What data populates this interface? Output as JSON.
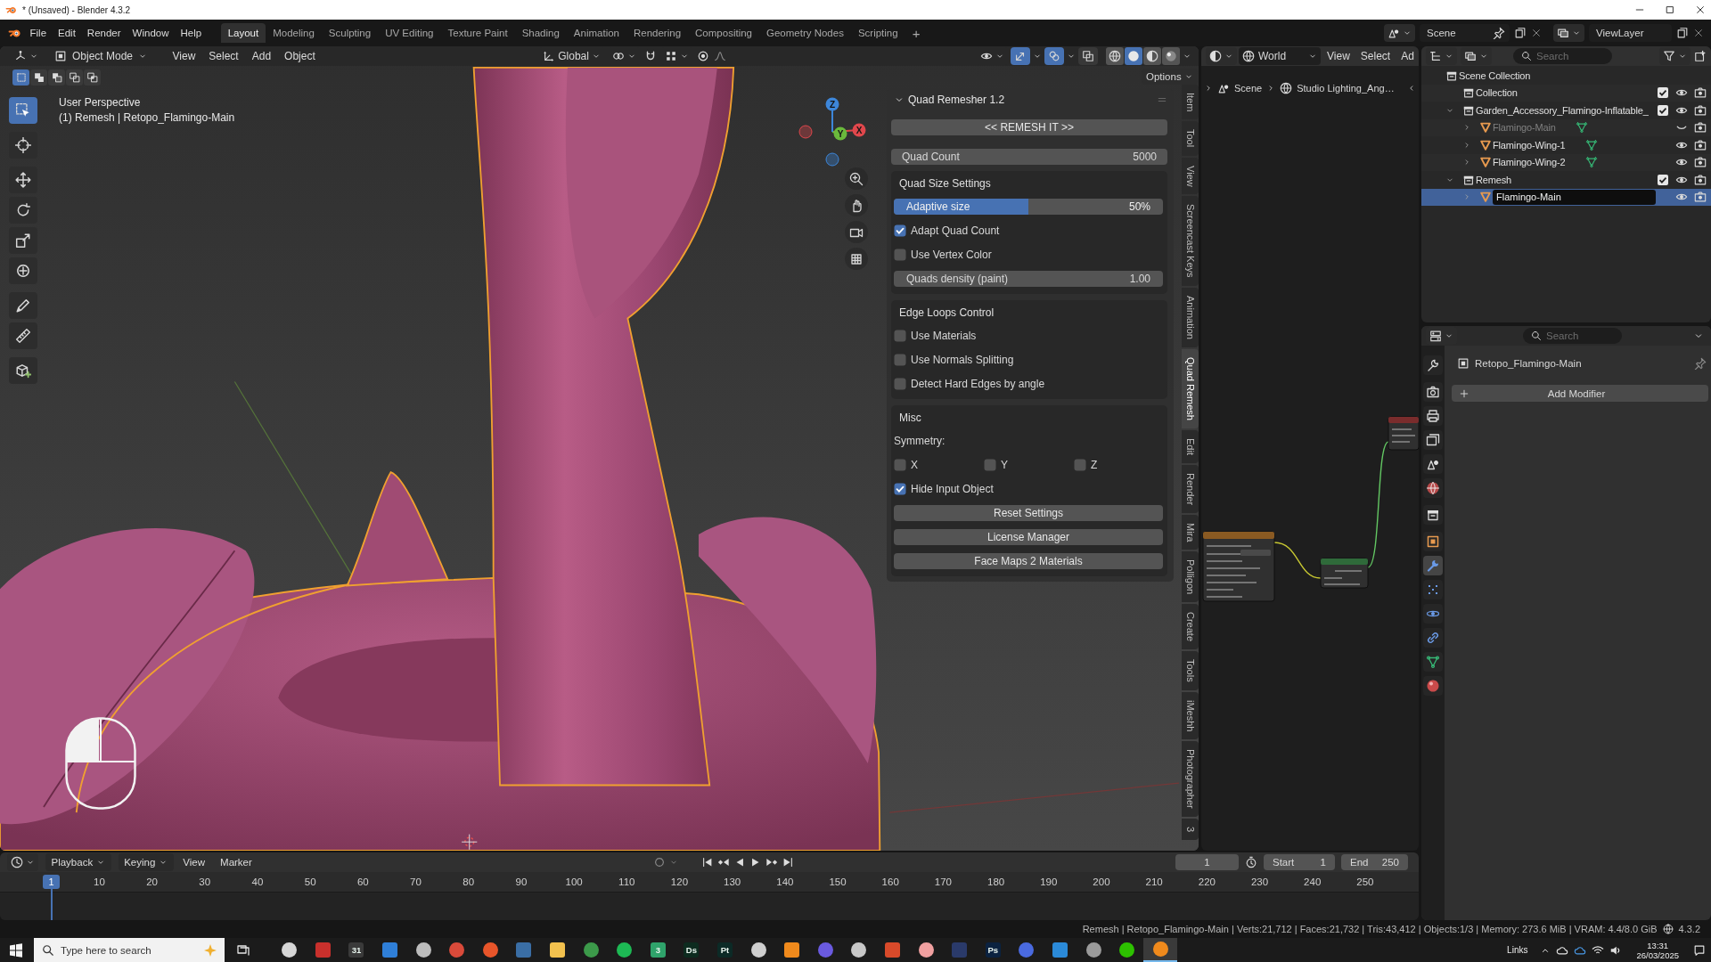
{
  "window": {
    "title": "* (Unsaved) - Blender 4.3.2"
  },
  "topbar": {
    "menus": [
      "File",
      "Edit",
      "Render",
      "Window",
      "Help"
    ],
    "workspaces": [
      {
        "label": "Layout",
        "selected": true
      },
      {
        "label": "Modeling",
        "selected": false
      },
      {
        "label": "Sculpting",
        "selected": false
      },
      {
        "label": "UV Editing",
        "selected": false
      },
      {
        "label": "Texture Paint",
        "selected": false
      },
      {
        "label": "Shading",
        "selected": false
      },
      {
        "label": "Animation",
        "selected": false
      },
      {
        "label": "Rendering",
        "selected": false
      },
      {
        "label": "Compositing",
        "selected": false
      },
      {
        "label": "Geometry Nodes",
        "selected": false
      },
      {
        "label": "Scripting",
        "selected": false
      }
    ],
    "add_workspace": "+",
    "scene": "Scene",
    "view_layer": "ViewLayer"
  },
  "viewport": {
    "mode": "Object Mode",
    "menus": [
      "View",
      "Select",
      "Add",
      "Object"
    ],
    "orientation": "Global",
    "toggles": [
      {
        "on": true
      },
      {
        "on": true
      },
      {
        "on": false
      }
    ],
    "shading": [
      {
        "selected": false
      },
      {
        "selected": true
      },
      {
        "selected": false
      },
      {
        "selected": false
      }
    ],
    "select_modes": [
      {
        "selected": true
      },
      {
        "selected": false
      },
      {
        "selected": false
      },
      {
        "selected": false
      },
      {
        "selected": false
      }
    ],
    "options": "Options",
    "info": [
      "User Perspective",
      "(1) Remesh | Retopo_Flamingo-Main"
    ],
    "tools": [
      {
        "selected": true
      },
      {
        "selected": false
      },
      {
        "selected": false
      },
      {
        "selected": false
      },
      {
        "selected": false
      },
      {
        "selected": false
      },
      {
        "selected": false
      },
      {
        "selected": false
      },
      {
        "selected": false
      }
    ],
    "gizmo": [
      {
        "label": "X",
        "color": "#e0474c"
      },
      {
        "label": "Y",
        "color": "#6ab93c"
      },
      {
        "label": "Z",
        "color": "#3d86d9"
      }
    ]
  },
  "sidebar_tabs": [
    {
      "label": "Item",
      "selected": false
    },
    {
      "label": "Tool",
      "selected": false
    },
    {
      "label": "View",
      "selected": false
    },
    {
      "label": "Screencast Keys",
      "selected": false
    },
    {
      "label": "Animation",
      "selected": false
    },
    {
      "label": "Quad Remesh",
      "selected": true
    },
    {
      "label": "Edit",
      "selected": false
    },
    {
      "label": "Render",
      "selected": false
    },
    {
      "label": "Mira",
      "selected": false
    },
    {
      "label": "Polligon",
      "selected": false
    },
    {
      "label": "Create",
      "selected": false
    },
    {
      "label": "Tools",
      "selected": false
    },
    {
      "label": "iMeshh",
      "selected": false
    },
    {
      "label": "Photographer",
      "selected": false
    },
    {
      "label": "3",
      "selected": false
    }
  ],
  "quad_remesher": {
    "title": "Quad Remesher 1.2",
    "expanded": true,
    "remesh_button": "<< REMESH IT >>",
    "quad_count": {
      "label": "Quad Count",
      "value": "5000"
    },
    "sections": [
      {
        "title": "Quad Size Settings",
        "rows": [
          {
            "kind": "slider",
            "label": "Adaptive size",
            "value": "50%",
            "level": 0.5
          },
          {
            "kind": "checkbox",
            "label": "Adapt Quad Count",
            "checked": true
          },
          {
            "kind": "checkbox",
            "label": "Use Vertex Color",
            "checked": false
          },
          {
            "kind": "number",
            "label": "Quads density (paint)",
            "value": "1.00"
          }
        ]
      },
      {
        "title": "Edge Loops Control",
        "rows": [
          {
            "kind": "checkbox",
            "label": "Use Materials",
            "checked": false
          },
          {
            "kind": "checkbox",
            "label": "Use Normals Splitting",
            "checked": false
          },
          {
            "kind": "checkbox",
            "label": "Detect Hard Edges by angle",
            "checked": false
          }
        ]
      },
      {
        "title": "Misc",
        "rows": [
          {
            "kind": "label",
            "label": "Symmetry:"
          },
          {
            "kind": "axes",
            "items": [
              {
                "label": "X",
                "checked": false
              },
              {
                "label": "Y",
                "checked": false
              },
              {
                "label": "Z",
                "checked": false
              }
            ]
          },
          {
            "kind": "checkbox",
            "label": "Hide Input Object",
            "checked": true
          },
          {
            "kind": "button",
            "label": "Reset Settings"
          },
          {
            "kind": "button",
            "label": "License Manager"
          },
          {
            "kind": "button",
            "label": "Face Maps 2 Materials"
          }
        ]
      }
    ]
  },
  "node_editor": {
    "world": "World",
    "menus": [
      "View",
      "Select",
      "Ad"
    ],
    "breadcrumbs": [
      {
        "label": "Scene",
        "kind": "scene"
      },
      {
        "label": "Studio Lighting_Ang…",
        "kind": "world"
      }
    ]
  },
  "outliner": {
    "search_placeholder": "Search",
    "tree": [
      {
        "label": "Scene Collection",
        "kind": "scene",
        "selected": false,
        "children": [
          {
            "label": "Collection",
            "kind": "collection",
            "selected": false,
            "checked": true,
            "visible": true
          },
          {
            "label": "Garden_Accessory_Flamingo-Inflatable_",
            "kind": "collection",
            "selected": false,
            "expanded": true,
            "checked": true,
            "visible": true,
            "children": [
              {
                "label": "Flamingo-Main",
                "kind": "object",
                "selected": false,
                "expanded": false,
                "visible": false,
                "renaming": false
              },
              {
                "label": "Flamingo-Wing-1",
                "kind": "object",
                "selected": false,
                "expanded": false,
                "visible": true,
                "renaming": false
              },
              {
                "label": "Flamingo-Wing-2",
                "kind": "object",
                "selected": false,
                "expanded": false,
                "visible": true,
                "renaming": false
              }
            ]
          },
          {
            "label": "Remesh",
            "kind": "collection",
            "selected": false,
            "expanded": true,
            "checked": true,
            "visible": true,
            "children": [
              {
                "label": "Flamingo-Main",
                "kind": "object",
                "selected": true,
                "expanded": false,
                "visible": true,
                "renaming": true
              }
            ]
          }
        ]
      }
    ]
  },
  "properties": {
    "search_placeholder": "Search",
    "tabs": [
      {
        "selected": false
      },
      {
        "selected": false
      },
      {
        "selected": false
      },
      {
        "selected": false
      },
      {
        "selected": false
      },
      {
        "selected": false
      },
      {
        "selected": false
      },
      {
        "selected": false
      },
      {
        "selected": true
      },
      {
        "selected": false
      },
      {
        "selected": false
      },
      {
        "selected": false
      },
      {
        "selected": false
      },
      {
        "selected": false
      }
    ],
    "object": "Retopo_Flamingo-Main",
    "add_modifier": "Add Modifier"
  },
  "timeline": {
    "menus": [
      {
        "label": "Playback",
        "kind": "dropdown"
      },
      {
        "label": "Keying",
        "kind": "dropdown"
      },
      {
        "label": "View",
        "kind": "menu"
      },
      {
        "label": "Marker",
        "kind": "menu"
      }
    ],
    "frame": "1",
    "start_label": "Start",
    "start": "1",
    "end_label": "End",
    "end": "250",
    "current_frame": "1",
    "ticks": [
      "10",
      "20",
      "30",
      "40",
      "50",
      "60",
      "70",
      "80",
      "90",
      "100",
      "110",
      "120",
      "130",
      "140",
      "150",
      "160",
      "170",
      "180",
      "190",
      "200",
      "210",
      "220",
      "230",
      "240",
      "250"
    ]
  },
  "status_bar": {
    "stats": "Remesh | Retopo_Flamingo-Main | Verts:21,712 | Faces:21,732 | Tris:43,412 | Objects:1/3 | Memory: 273.6 MiB | VRAM: 4.4/8.0 GiB",
    "version": "4.3.2"
  },
  "taskbar": {
    "search_placeholder": "Type here to search",
    "apps": [
      {
        "kind": "circle",
        "color": "#d6d6d6",
        "active": false
      },
      {
        "kind": "tile",
        "color": "#c8302c",
        "active": false
      },
      {
        "kind": "letters",
        "color": "#3a3a3a",
        "label": "31",
        "active": false
      },
      {
        "kind": "tile",
        "color": "#2f7fd8",
        "active": false
      },
      {
        "kind": "circle",
        "color": "#bdbdbd",
        "active": false
      },
      {
        "kind": "circle",
        "color": "#d94a3a",
        "active": false
      },
      {
        "kind": "circle",
        "color": "#e8552a",
        "active": false
      },
      {
        "kind": "tile",
        "color": "#3a6ea5",
        "active": false
      },
      {
        "kind": "tile",
        "color": "#f2c14e",
        "active": false
      },
      {
        "kind": "circle",
        "color": "#3c9a4a",
        "active": false
      },
      {
        "kind": "circle",
        "color": "#1db954",
        "active": false
      },
      {
        "kind": "letters",
        "color": "#2fa36b",
        "label": "3",
        "active": false
      },
      {
        "kind": "letters",
        "color": "#0d2b1f",
        "label": "Ds",
        "active": false
      },
      {
        "kind": "letters",
        "color": "#0c2a26",
        "label": "Pt",
        "active": false
      },
      {
        "kind": "circle",
        "color": "#cfcfcf",
        "active": false
      },
      {
        "kind": "tile",
        "color": "#f08a1c",
        "active": false
      },
      {
        "kind": "circle",
        "color": "#6a5ae0",
        "active": false
      },
      {
        "kind": "circle",
        "color": "#c8c8c8",
        "active": false
      },
      {
        "kind": "tile",
        "color": "#d84a2a",
        "active": false
      },
      {
        "kind": "circle",
        "color": "#f0a0a0",
        "active": false
      },
      {
        "kind": "tile",
        "color": "#2a3a6a",
        "active": false
      },
      {
        "kind": "letters",
        "color": "#0b2240",
        "label": "Ps",
        "active": false
      },
      {
        "kind": "circle",
        "color": "#4a6ae0",
        "active": false
      },
      {
        "kind": "tile",
        "color": "#2b8ad8",
        "active": false
      },
      {
        "kind": "circle",
        "color": "#9a9a9a",
        "active": false
      },
      {
        "kind": "circle",
        "color": "#2dc100",
        "active": false
      },
      {
        "kind": "circle",
        "color": "#f08a1c",
        "active": true
      }
    ],
    "tray_label": "Links",
    "time": "13:31",
    "date": "26/03/2025"
  }
}
